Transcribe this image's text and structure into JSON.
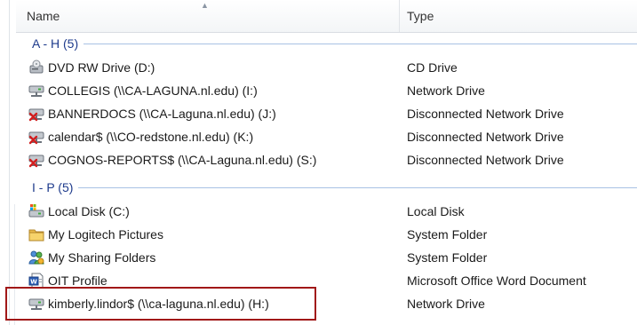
{
  "columns": {
    "name": "Name",
    "type": "Type"
  },
  "groups": [
    {
      "label": "A - H (5)"
    },
    {
      "label": "I - P (5)"
    }
  ],
  "rows": [
    {
      "name": "DVD RW Drive (D:)",
      "type": "CD Drive",
      "icon": "dvd-drive-icon"
    },
    {
      "name": "COLLEGIS (\\\\CA-LAGUNA.nl.edu) (I:)",
      "type": "Network Drive",
      "icon": "network-drive-icon"
    },
    {
      "name": "BANNERDOCS (\\\\CA-Laguna.nl.edu) (J:)",
      "type": "Disconnected Network Drive",
      "icon": "disconnected-network-drive-icon"
    },
    {
      "name": "calendar$ (\\\\CO-redstone.nl.edu) (K:)",
      "type": "Disconnected Network Drive",
      "icon": "disconnected-network-drive-icon"
    },
    {
      "name": "COGNOS-REPORTS$ (\\\\CA-Laguna.nl.edu) (S:)",
      "type": "Disconnected Network Drive",
      "icon": "disconnected-network-drive-icon"
    },
    {
      "name": "Local Disk (C:)",
      "type": "Local Disk",
      "icon": "local-disk-icon"
    },
    {
      "name": "My Logitech Pictures",
      "type": "System Folder",
      "icon": "folder-icon"
    },
    {
      "name": "My Sharing Folders",
      "type": "System Folder",
      "icon": "sharing-folder-icon"
    },
    {
      "name": "OIT Profile",
      "type": "Microsoft Office Word Document",
      "icon": "word-document-icon"
    },
    {
      "name": "kimberly.lindor$ (\\\\ca-laguna.nl.edu) (H:)",
      "type": "Network Drive",
      "icon": "network-drive-icon"
    }
  ],
  "colors": {
    "group_text": "#1e3b8c",
    "group_line": "#a9c2e4",
    "highlight_border": "#a11818"
  }
}
